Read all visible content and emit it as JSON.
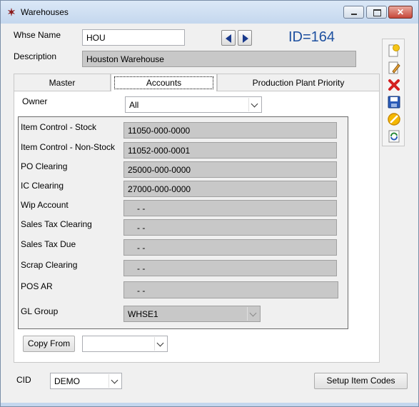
{
  "window": {
    "title": "Warehouses"
  },
  "header": {
    "whse_name_label": "Whse Name",
    "whse_name_value": "HOU",
    "description_label": "Description",
    "description_value": "Houston Warehouse",
    "id_text": "ID=164"
  },
  "tabs": [
    {
      "label": "Master",
      "active": false
    },
    {
      "label": "Accounts",
      "active": true
    },
    {
      "label": "Production Plant Priority",
      "active": false
    }
  ],
  "accounts": {
    "owner_label": "Owner",
    "owner_value": "All",
    "rows": [
      {
        "label": "Item Control - Stock",
        "value": "11050-000-0000"
      },
      {
        "label": "Item Control - Non-Stock",
        "value": "11052-000-0001"
      },
      {
        "label": "PO Clearing",
        "value": "25000-000-0000"
      },
      {
        "label": "IC Clearing",
        "value": "27000-000-0000"
      },
      {
        "label": "Wip Account",
        "value": "-  -"
      },
      {
        "label": "Sales Tax Clearing",
        "value": "-  -"
      },
      {
        "label": "Sales Tax Due",
        "value": "-  -"
      },
      {
        "label": "Scrap Clearing",
        "value": "-  -"
      },
      {
        "label": "POS AR",
        "value": "-  -"
      }
    ],
    "gl_group_label": "GL Group",
    "gl_group_value": "WHSE1",
    "copy_from_label": "Copy From",
    "copy_from_value": ""
  },
  "footer": {
    "cid_label": "CID",
    "cid_value": "DEMO",
    "setup_item_codes_label": "Setup Item Codes"
  },
  "toolbar": {
    "icons": [
      "new-record-icon",
      "edit-icon",
      "delete-icon",
      "save-icon",
      "cancel-icon",
      "refresh-icon"
    ]
  },
  "colors": {
    "id_text": "#1e50a0",
    "readonly_field": "#c8c8c8"
  }
}
